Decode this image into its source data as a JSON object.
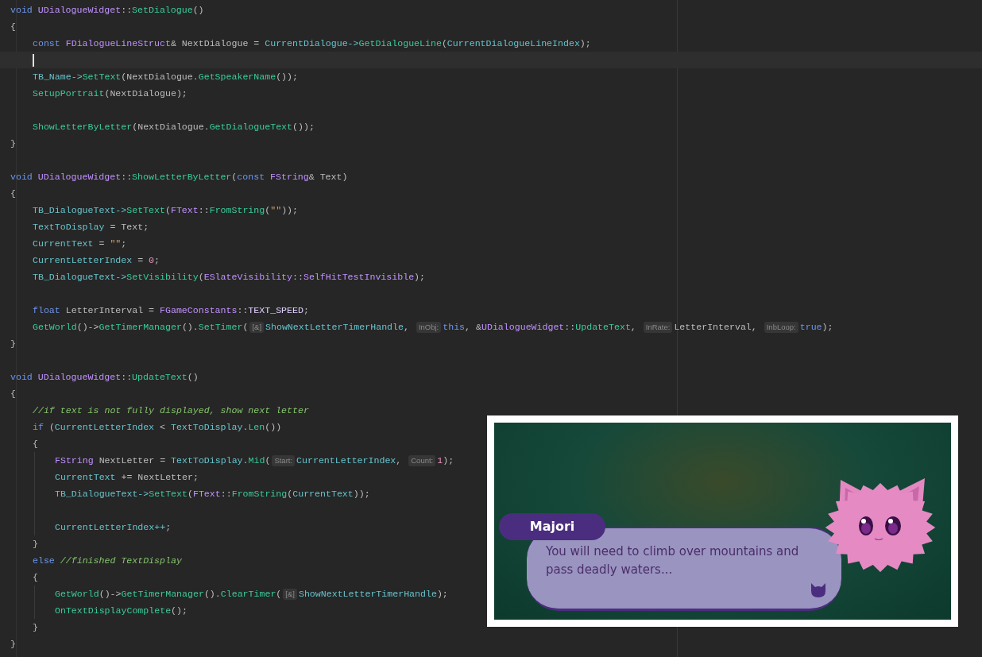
{
  "editor": {
    "lines": [
      {
        "kind": "code",
        "tokens": [
          {
            "kind": "kw",
            "text": "void "
          },
          {
            "kind": "type",
            "text": "UDialogueWidget"
          },
          {
            "kind": "plain",
            "text": "::"
          },
          {
            "kind": "fn",
            "text": "SetDialogue"
          },
          {
            "kind": "plain",
            "text": "()"
          }
        ]
      },
      {
        "kind": "code",
        "tokens": [
          {
            "kind": "plain",
            "text": "{"
          }
        ],
        "children": [
          {
            "kind": "code",
            "tokens": [
              {
                "kind": "kw",
                "text": "const "
              },
              {
                "kind": "type",
                "text": "FDialogueLineStruct"
              },
              {
                "kind": "plain",
                "text": "& NextDialogue = "
              },
              {
                "kind": "field",
                "text": "CurrentDialogue->"
              },
              {
                "kind": "fn",
                "text": "GetDialogueLine"
              },
              {
                "kind": "plain",
                "text": "("
              },
              {
                "kind": "field",
                "text": "CurrentDialogueLineIndex"
              },
              {
                "kind": "plain",
                "text": ");"
              }
            ]
          },
          {
            "kind": "caret"
          },
          {
            "kind": "code",
            "tokens": [
              {
                "kind": "field",
                "text": "TB_Name->"
              },
              {
                "kind": "fn",
                "text": "SetText"
              },
              {
                "kind": "plain",
                "text": "(NextDialogue."
              },
              {
                "kind": "fn",
                "text": "GetSpeakerName"
              },
              {
                "kind": "plain",
                "text": "());"
              }
            ]
          },
          {
            "kind": "code",
            "tokens": [
              {
                "kind": "fn",
                "text": "SetupPortrait"
              },
              {
                "kind": "plain",
                "text": "(NextDialogue);"
              }
            ]
          },
          {
            "kind": "blank"
          },
          {
            "kind": "code",
            "tokens": [
              {
                "kind": "fn",
                "text": "ShowLetterByLetter"
              },
              {
                "kind": "plain",
                "text": "(NextDialogue."
              },
              {
                "kind": "fn",
                "text": "GetDialogueText"
              },
              {
                "kind": "plain",
                "text": "());"
              }
            ]
          }
        ]
      },
      {
        "kind": "code",
        "tokens": [
          {
            "kind": "plain",
            "text": "}"
          }
        ]
      },
      {
        "kind": "blank"
      },
      {
        "kind": "code",
        "tokens": [
          {
            "kind": "kw",
            "text": "void "
          },
          {
            "kind": "type",
            "text": "UDialogueWidget"
          },
          {
            "kind": "plain",
            "text": "::"
          },
          {
            "kind": "fn",
            "text": "ShowLetterByLetter"
          },
          {
            "kind": "plain",
            "text": "("
          },
          {
            "kind": "kw",
            "text": "const "
          },
          {
            "kind": "type",
            "text": "FString"
          },
          {
            "kind": "plain",
            "text": "& Text)"
          }
        ]
      },
      {
        "kind": "code",
        "tokens": [
          {
            "kind": "plain",
            "text": "{"
          }
        ],
        "children": [
          {
            "kind": "code",
            "tokens": [
              {
                "kind": "field",
                "text": "TB_DialogueText->"
              },
              {
                "kind": "fn",
                "text": "SetText"
              },
              {
                "kind": "plain",
                "text": "("
              },
              {
                "kind": "type",
                "text": "FText"
              },
              {
                "kind": "plain",
                "text": "::"
              },
              {
                "kind": "fn",
                "text": "FromString"
              },
              {
                "kind": "plain",
                "text": "("
              },
              {
                "kind": "str",
                "text": "\"\""
              },
              {
                "kind": "plain",
                "text": "));"
              }
            ]
          },
          {
            "kind": "code",
            "tokens": [
              {
                "kind": "field",
                "text": "TextToDisplay"
              },
              {
                "kind": "plain",
                "text": " = Text;"
              }
            ]
          },
          {
            "kind": "code",
            "tokens": [
              {
                "kind": "field",
                "text": "CurrentText"
              },
              {
                "kind": "plain",
                "text": " = "
              },
              {
                "kind": "str",
                "text": "\"\""
              },
              {
                "kind": "plain",
                "text": ";"
              }
            ]
          },
          {
            "kind": "code",
            "tokens": [
              {
                "kind": "field",
                "text": "CurrentLetterIndex"
              },
              {
                "kind": "plain",
                "text": " = "
              },
              {
                "kind": "num",
                "text": "0"
              },
              {
                "kind": "plain",
                "text": ";"
              }
            ]
          },
          {
            "kind": "code",
            "tokens": [
              {
                "kind": "field",
                "text": "TB_DialogueText->"
              },
              {
                "kind": "fn",
                "text": "SetVisibility"
              },
              {
                "kind": "plain",
                "text": "("
              },
              {
                "kind": "type",
                "text": "ESlateVisibility"
              },
              {
                "kind": "plain",
                "text": "::"
              },
              {
                "kind": "macro",
                "text": "SelfHitTestInvisible"
              },
              {
                "kind": "plain",
                "text": ");"
              }
            ]
          },
          {
            "kind": "blank"
          },
          {
            "kind": "code",
            "tokens": [
              {
                "kind": "kw",
                "text": "float"
              },
              {
                "kind": "plain",
                "text": " LetterInterval = "
              },
              {
                "kind": "type",
                "text": "FGameConstants"
              },
              {
                "kind": "plain",
                "text": "::"
              },
              {
                "kind": "const",
                "text": "TEXT_SPEED"
              },
              {
                "kind": "plain",
                "text": ";"
              }
            ]
          },
          {
            "kind": "code",
            "tokens": [
              {
                "kind": "fn",
                "text": "GetWorld"
              },
              {
                "kind": "plain",
                "text": "()->"
              },
              {
                "kind": "fn",
                "text": "GetTimerManager"
              },
              {
                "kind": "plain",
                "text": "()."
              },
              {
                "kind": "fn",
                "text": "SetTimer"
              },
              {
                "kind": "plain",
                "text": "("
              },
              {
                "kind": "hint",
                "text": "[&]"
              },
              {
                "kind": "field",
                "text": "ShowNextLetterTimerHandle"
              },
              {
                "kind": "plain",
                "text": ", "
              },
              {
                "kind": "hint",
                "text": "InObj:"
              },
              {
                "kind": "kw",
                "text": "this"
              },
              {
                "kind": "plain",
                "text": ", &"
              },
              {
                "kind": "type",
                "text": "UDialogueWidget"
              },
              {
                "kind": "plain",
                "text": "::"
              },
              {
                "kind": "fn",
                "text": "UpdateText"
              },
              {
                "kind": "plain",
                "text": ", "
              },
              {
                "kind": "hint",
                "text": "InRate:"
              },
              {
                "kind": "plain",
                "text": "LetterInterval, "
              },
              {
                "kind": "hint",
                "text": "InbLoop:"
              },
              {
                "kind": "kw",
                "text": "true"
              },
              {
                "kind": "plain",
                "text": ");"
              }
            ]
          }
        ]
      },
      {
        "kind": "code",
        "tokens": [
          {
            "kind": "plain",
            "text": "}"
          }
        ]
      },
      {
        "kind": "blank"
      },
      {
        "kind": "code",
        "tokens": [
          {
            "kind": "kw",
            "text": "void "
          },
          {
            "kind": "type",
            "text": "UDialogueWidget"
          },
          {
            "kind": "plain",
            "text": "::"
          },
          {
            "kind": "fn",
            "text": "UpdateText"
          },
          {
            "kind": "plain",
            "text": "()"
          }
        ]
      },
      {
        "kind": "code",
        "tokens": [
          {
            "kind": "plain",
            "text": "{"
          }
        ],
        "children": [
          {
            "kind": "code",
            "tokens": [
              {
                "kind": "comment",
                "text": "//if text is not fully displayed, show next letter"
              }
            ]
          },
          {
            "kind": "code",
            "tokens": [
              {
                "kind": "kw",
                "text": "if"
              },
              {
                "kind": "plain",
                "text": " ("
              },
              {
                "kind": "field",
                "text": "CurrentLetterIndex"
              },
              {
                "kind": "plain",
                "text": " < "
              },
              {
                "kind": "field",
                "text": "TextToDisplay"
              },
              {
                "kind": "plain",
                "text": "."
              },
              {
                "kind": "fn",
                "text": "Len"
              },
              {
                "kind": "plain",
                "text": "())"
              }
            ]
          },
          {
            "kind": "code",
            "tokens": [
              {
                "kind": "plain",
                "text": "{"
              }
            ],
            "children": [
              {
                "kind": "code",
                "tokens": [
                  {
                    "kind": "type",
                    "text": "FString"
                  },
                  {
                    "kind": "plain",
                    "text": " NextLetter = "
                  },
                  {
                    "kind": "field",
                    "text": "TextToDisplay"
                  },
                  {
                    "kind": "plain",
                    "text": "."
                  },
                  {
                    "kind": "fn",
                    "text": "Mid"
                  },
                  {
                    "kind": "plain",
                    "text": "("
                  },
                  {
                    "kind": "hint",
                    "text": "Start:"
                  },
                  {
                    "kind": "field",
                    "text": "CurrentLetterIndex"
                  },
                  {
                    "kind": "plain",
                    "text": ", "
                  },
                  {
                    "kind": "hint",
                    "text": "Count:"
                  },
                  {
                    "kind": "num",
                    "text": "1"
                  },
                  {
                    "kind": "plain",
                    "text": ");"
                  }
                ]
              },
              {
                "kind": "code",
                "tokens": [
                  {
                    "kind": "field",
                    "text": "CurrentText"
                  },
                  {
                    "kind": "plain",
                    "text": " += NextLetter;"
                  }
                ]
              },
              {
                "kind": "code",
                "tokens": [
                  {
                    "kind": "field",
                    "text": "TB_DialogueText->"
                  },
                  {
                    "kind": "fn",
                    "text": "SetText"
                  },
                  {
                    "kind": "plain",
                    "text": "("
                  },
                  {
                    "kind": "type",
                    "text": "FText"
                  },
                  {
                    "kind": "plain",
                    "text": "::"
                  },
                  {
                    "kind": "fn",
                    "text": "FromString"
                  },
                  {
                    "kind": "plain",
                    "text": "("
                  },
                  {
                    "kind": "field",
                    "text": "CurrentText"
                  },
                  {
                    "kind": "plain",
                    "text": "));"
                  }
                ]
              },
              {
                "kind": "blank"
              },
              {
                "kind": "code",
                "tokens": [
                  {
                    "kind": "field",
                    "text": "CurrentLetterIndex++"
                  },
                  {
                    "kind": "plain",
                    "text": ";"
                  }
                ]
              }
            ]
          },
          {
            "kind": "code",
            "tokens": [
              {
                "kind": "plain",
                "text": "}"
              }
            ]
          },
          {
            "kind": "code",
            "tokens": [
              {
                "kind": "kw",
                "text": "else "
              },
              {
                "kind": "comment",
                "text": "//finished TextDisplay"
              }
            ]
          },
          {
            "kind": "code",
            "tokens": [
              {
                "kind": "plain",
                "text": "{"
              }
            ],
            "children": [
              {
                "kind": "code",
                "tokens": [
                  {
                    "kind": "fn",
                    "text": "GetWorld"
                  },
                  {
                    "kind": "plain",
                    "text": "()->"
                  },
                  {
                    "kind": "fn",
                    "text": "GetTimerManager"
                  },
                  {
                    "kind": "plain",
                    "text": "()."
                  },
                  {
                    "kind": "fn",
                    "text": "ClearTimer"
                  },
                  {
                    "kind": "plain",
                    "text": "("
                  },
                  {
                    "kind": "hint",
                    "text": "[&]"
                  },
                  {
                    "kind": "field",
                    "text": "ShowNextLetterTimerHandle"
                  },
                  {
                    "kind": "plain",
                    "text": ");"
                  }
                ]
              },
              {
                "kind": "code",
                "tokens": [
                  {
                    "kind": "fn",
                    "text": "OnTextDisplayComplete"
                  },
                  {
                    "kind": "plain",
                    "text": "();"
                  }
                ]
              }
            ]
          },
          {
            "kind": "code",
            "tokens": [
              {
                "kind": "plain",
                "text": "}"
              }
            ]
          }
        ]
      },
      {
        "kind": "code",
        "tokens": [
          {
            "kind": "plain",
            "text": "}"
          }
        ]
      }
    ]
  },
  "game_preview": {
    "speaker": "Majori",
    "dialogue": "You will need to climb over mountains and pass deadly waters..."
  }
}
